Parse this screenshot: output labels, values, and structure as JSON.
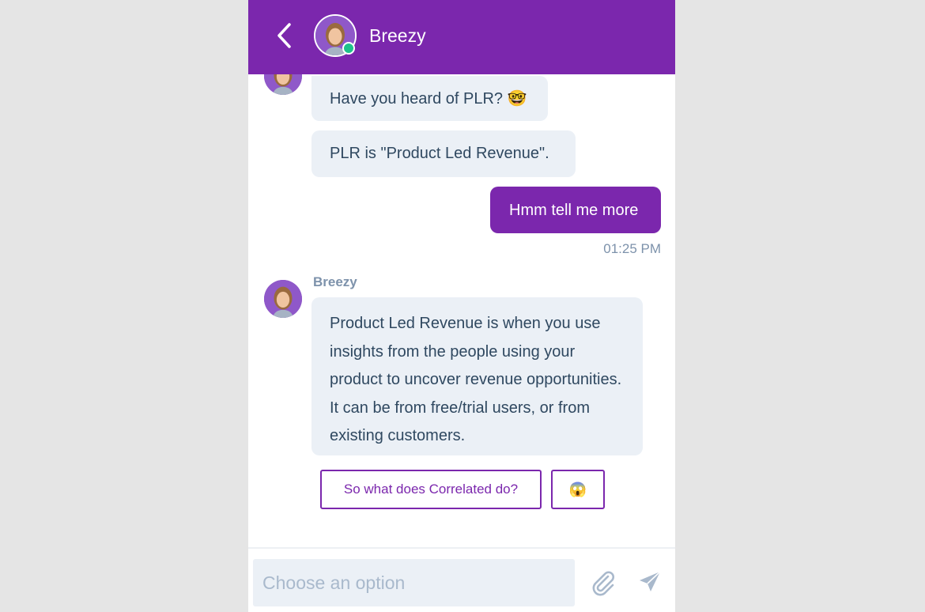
{
  "header": {
    "title": "Breezy",
    "back_icon": "chevron-left-icon",
    "status": "online"
  },
  "messages": [
    {
      "from": "bot",
      "text": "Have you heard of PLR? 🤓"
    },
    {
      "from": "bot",
      "text": "PLR is \"Product Led Revenue\"."
    },
    {
      "from": "user",
      "text": "Hmm tell me more",
      "time": "01:25 PM"
    },
    {
      "from": "bot",
      "sender": "Breezy",
      "text": "Product Led Revenue is when you use insights from the people using your product to uncover revenue opportunities. It can be from free/trial users, or from existing customers."
    }
  ],
  "quick_replies": [
    "So what does Correlated do?",
    "😱"
  ],
  "composer": {
    "placeholder": "Choose an option",
    "value": "",
    "attach_icon": "paperclip-icon",
    "send_icon": "send-icon"
  },
  "colors": {
    "brand": "#7b27ad",
    "bubble_in": "#ebf0f6",
    "text_dark": "#2f4860",
    "meta": "#7d92ab",
    "online": "#1ec28b",
    "background": "#e5e5e5"
  }
}
